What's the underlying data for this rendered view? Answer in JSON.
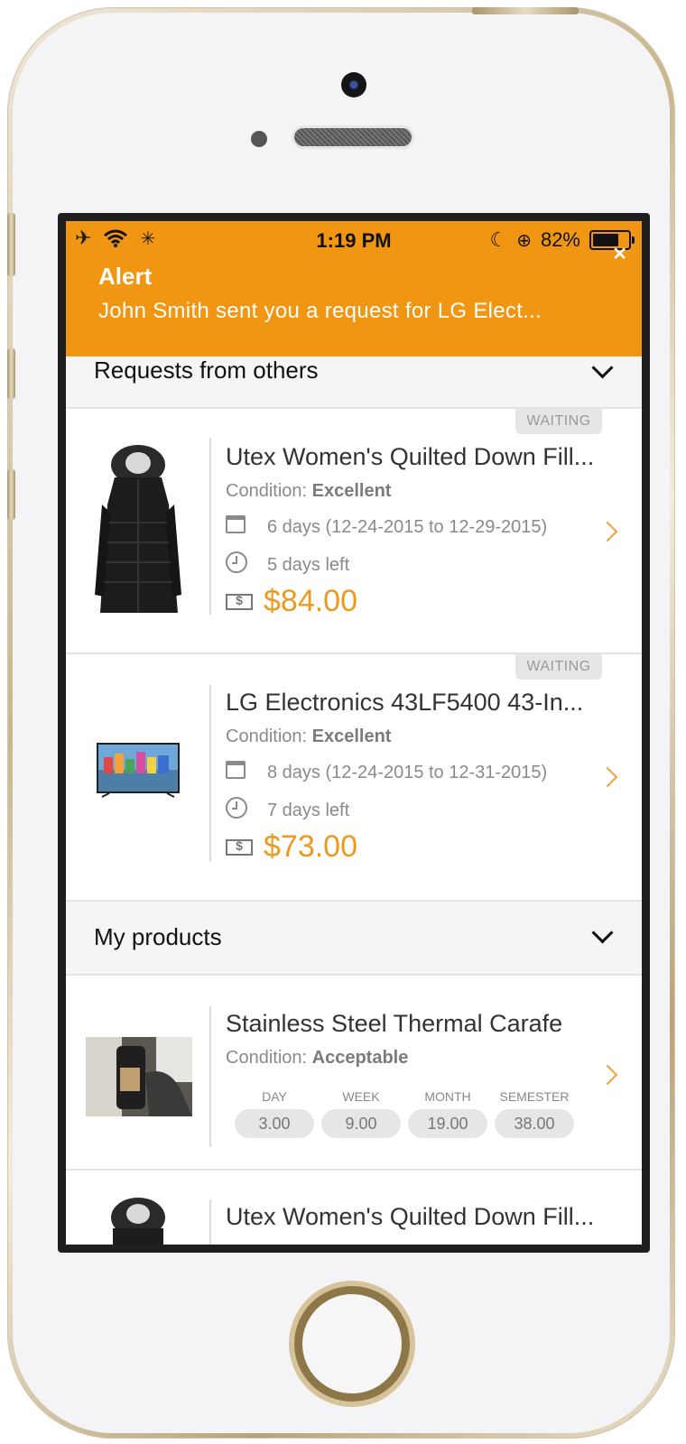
{
  "status_bar": {
    "time": "1:19 PM",
    "battery": "82%",
    "battery_level": 0.82,
    "icons": [
      "airplane-icon",
      "wifi-icon",
      "loading-icon",
      "moon-icon",
      "rotation-lock-icon",
      "battery-icon"
    ]
  },
  "alert": {
    "title": "Alert",
    "message": "John Smith sent you a request for LG Elect...",
    "close_icon": "close-icon"
  },
  "colors": {
    "accent": "#f09612",
    "price": "#eb9a1e",
    "header_bg": "#f5f5f5"
  },
  "sections": {
    "requests": {
      "title": "Requests from others",
      "items": [
        {
          "status": "WAITING",
          "title": "Utex Women's Quilted Down Fill...",
          "condition_label": "Condition:",
          "condition": "Excellent",
          "duration": "6 days (12-24-2015 to 12-29-2015)",
          "time_left": "5 days left",
          "price": "$84.00",
          "thumbnail": "coat-image"
        },
        {
          "status": "WAITING",
          "title": "LG Electronics 43LF5400 43-In...",
          "condition_label": "Condition:",
          "condition": "Excellent",
          "duration": "8 days (12-24-2015 to 12-31-2015)",
          "time_left": "7 days left",
          "price": "$73.00",
          "thumbnail": "tv-image"
        }
      ]
    },
    "my_products": {
      "title": "My products",
      "items": [
        {
          "title": "Stainless Steel Thermal Carafe",
          "condition_label": "Condition:",
          "condition": "Acceptable",
          "rates": [
            {
              "label": "DAY",
              "value": "3.00"
            },
            {
              "label": "WEEK",
              "value": "9.00"
            },
            {
              "label": "MONTH",
              "value": "19.00"
            },
            {
              "label": "SEMESTER",
              "value": "38.00"
            }
          ],
          "thumbnail": "carafe-image"
        },
        {
          "title": "Utex Women's Quilted Down Fill...",
          "thumbnail": "coat-image"
        }
      ]
    }
  }
}
